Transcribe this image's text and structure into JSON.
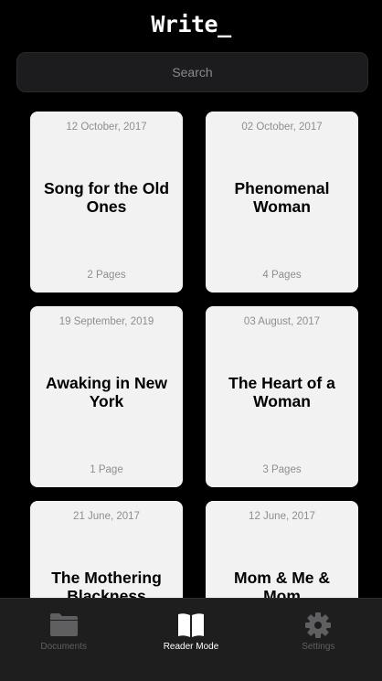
{
  "app": {
    "title": "Write_"
  },
  "search": {
    "placeholder": "Search"
  },
  "documents": [
    {
      "date": "12 October, 2017",
      "title": "Song for the Old Ones",
      "pages": "2 Pages"
    },
    {
      "date": "02 October, 2017",
      "title": "Phenomenal Woman",
      "pages": "4 Pages"
    },
    {
      "date": "19 September, 2019",
      "title": "Awaking in New York",
      "pages": "1 Page"
    },
    {
      "date": "03 August, 2017",
      "title": "The Heart of a Woman",
      "pages": "3 Pages"
    },
    {
      "date": "21 June, 2017",
      "title": "The Mothering Blackness",
      "pages": ""
    },
    {
      "date": "12 June, 2017",
      "title": "Mom & Me & Mom",
      "pages": ""
    }
  ],
  "tabbar": {
    "tabs": [
      {
        "label": "Documents",
        "icon": "folder-icon",
        "active": false
      },
      {
        "label": "Reader Mode",
        "icon": "book-icon",
        "active": true
      },
      {
        "label": "Settings",
        "icon": "gear-icon",
        "active": false
      }
    ]
  },
  "colors": {
    "background": "#000000",
    "card": "#f2f2f2",
    "tabbar": "#1e1e1e",
    "inactive": "#5f5f62"
  }
}
